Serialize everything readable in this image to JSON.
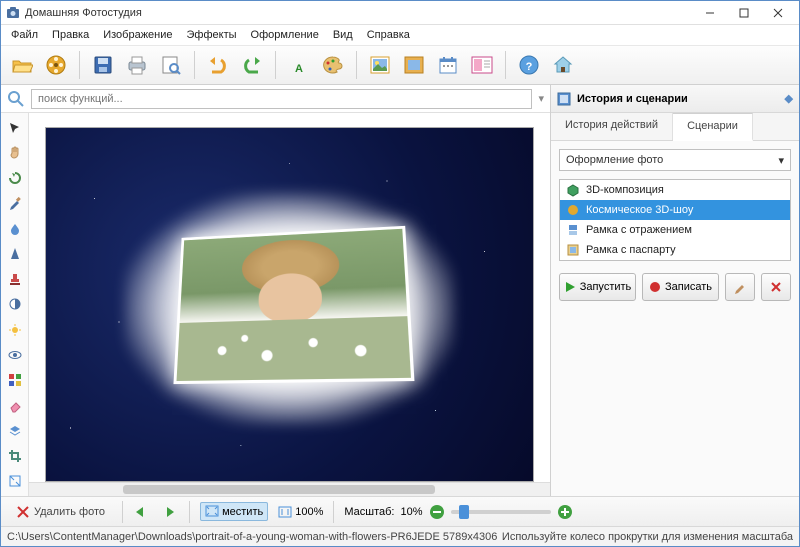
{
  "window": {
    "title": "Домашняя Фотостудия"
  },
  "menu": [
    "Файл",
    "Правка",
    "Изображение",
    "Эффекты",
    "Оформление",
    "Вид",
    "Справка"
  ],
  "search": {
    "placeholder": "поиск функций..."
  },
  "panel": {
    "title": "История и сценарии",
    "tabs": {
      "history": "История действий",
      "scenarios": "Сценарии"
    },
    "combo": "Оформление фото",
    "items": {
      "i0": "3D-композиция",
      "i1": "Космическое 3D-шоу",
      "i2": "Рамка с отражением",
      "i3": "Рамка с паспарту"
    },
    "run": "Запустить",
    "record": "Записать"
  },
  "bottom": {
    "delete": "Удалить фото",
    "fit": "местить",
    "oneToOne": "100%",
    "scaleLabel": "Масштаб:",
    "scaleValue": "10%"
  },
  "status": {
    "left": "C:\\Users\\ContentManager\\Downloads\\portrait-of-a-young-woman-with-flowers-PR6JEDE  5789x4306",
    "right": "Используйте колесо прокрутки для изменения масштаба"
  }
}
